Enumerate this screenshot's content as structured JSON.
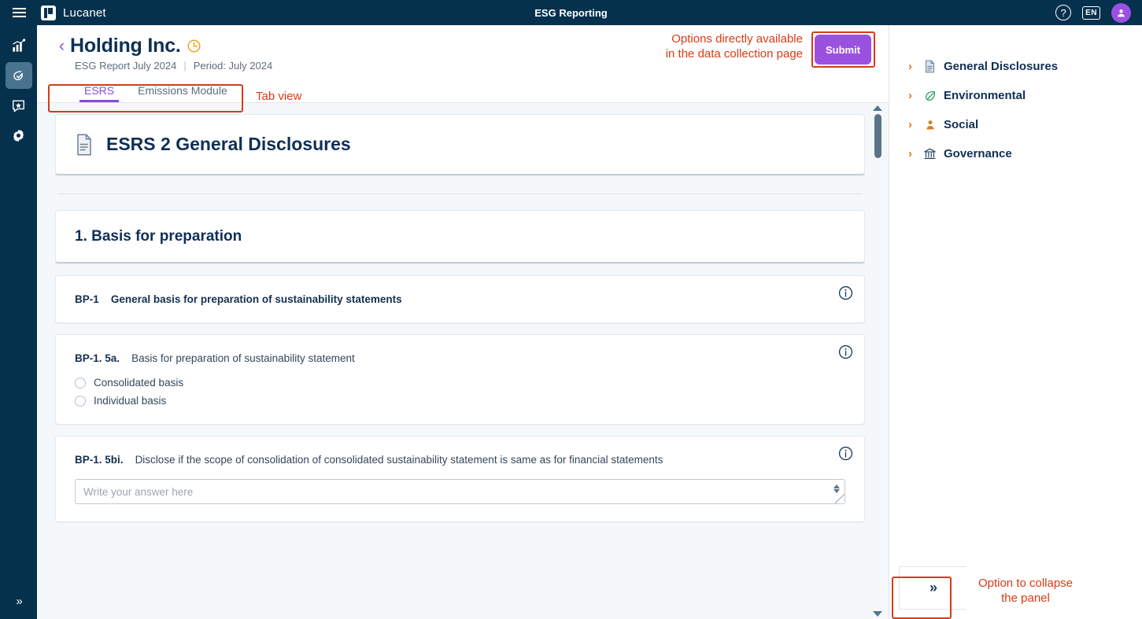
{
  "topbar": {
    "menu_icon": "hamburger-icon",
    "brand": "Lucanet",
    "title": "ESG Reporting",
    "help_icon": "question-mark-icon",
    "language": "EN",
    "avatar_icon": "user-avatar-icon"
  },
  "left_rail": {
    "items": [
      {
        "icon": "analytics-chart-icon",
        "active": false
      },
      {
        "icon": "esg-leaf-check-icon",
        "active": true
      },
      {
        "icon": "star-message-icon",
        "active": false
      },
      {
        "icon": "gear-settings-icon",
        "active": false
      }
    ],
    "expand_icon": "double-chevron-right-icon"
  },
  "page": {
    "back_icon": "chevron-left-icon",
    "title": "Holding Inc.",
    "status_icon": "clock-icon",
    "report_name": "ESG Report July 2024",
    "separator": "|",
    "period": "Period: July 2024",
    "submit_label": "Submit",
    "submit_color": "#9b51e0"
  },
  "tabs": [
    {
      "label": "ESRS",
      "active": true
    },
    {
      "label": "Emissions Module",
      "active": false
    }
  ],
  "annotations": [
    {
      "id": "submit-annotation",
      "text": "Options directly available\nin the data collection page"
    },
    {
      "id": "tabs-annotation",
      "text": "Tab view"
    },
    {
      "id": "collapse-annotation",
      "text": "Option to collapse\nthe panel"
    }
  ],
  "content": {
    "hero": {
      "icon": "document-icon",
      "title": "ESRS 2 General Disclosures"
    },
    "section": {
      "title": "1. Basis for preparation"
    },
    "questions": [
      {
        "code": "BP-1",
        "text": "General basis for preparation of sustainability statements",
        "text_bold": true,
        "info_icon": "info-circle-icon",
        "type": "header"
      },
      {
        "code": "BP-1. 5a.",
        "text": "Basis for preparation of sustainability statement",
        "text_bold": false,
        "info_icon": "info-circle-icon",
        "type": "radio",
        "options": [
          "Consolidated basis",
          "Individual basis"
        ]
      },
      {
        "code": "BP-1. 5bi.",
        "text": "Disclose if the scope of consolidation of consolidated sustainability statement is same as for financial statements",
        "text_bold": false,
        "info_icon": "info-circle-icon",
        "type": "textarea",
        "placeholder": "Write your answer here",
        "value": ""
      }
    ]
  },
  "right_panel": {
    "items": [
      {
        "label": "General Disclosures",
        "icon": "document-page-icon",
        "chevron": "chevron-right-icon"
      },
      {
        "label": "Environmental",
        "icon": "leaf-icon",
        "chevron": "chevron-right-icon"
      },
      {
        "label": "Social",
        "icon": "person-icon",
        "chevron": "chevron-right-icon"
      },
      {
        "label": "Governance",
        "icon": "bank-columns-icon",
        "chevron": "chevron-right-icon"
      }
    ],
    "collapse_label": "»"
  }
}
